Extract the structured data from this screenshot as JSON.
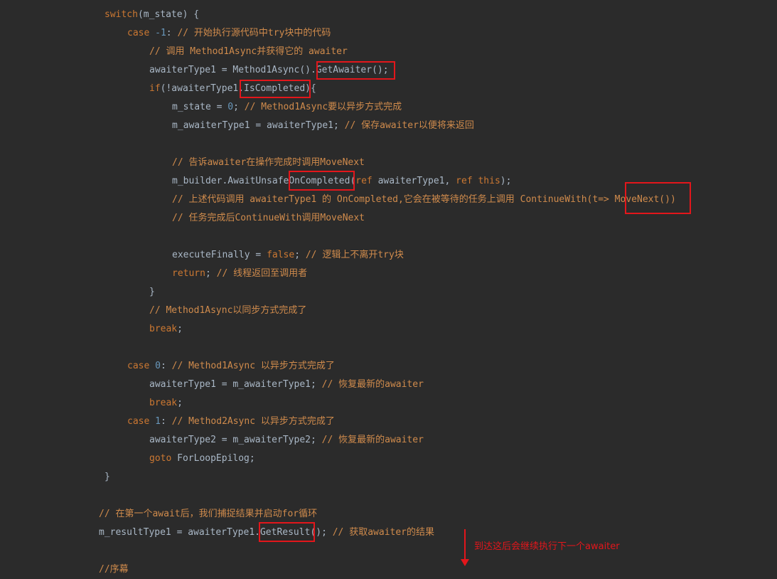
{
  "code_lines": [
    [
      {
        "t": "switch",
        "c": "kw"
      },
      {
        "t": "(m_state) {",
        "c": "pl"
      }
    ],
    [
      {
        "t": "case ",
        "c": "kw"
      },
      {
        "t": "-1",
        "c": "num"
      },
      {
        "t": ": ",
        "c": "pl"
      },
      {
        "t": "// 开始执行源代码中try块中的代码",
        "c": "cm"
      }
    ],
    [
      {
        "t": "// 调用 Method1Async并获得它的 awaiter",
        "c": "cm"
      }
    ],
    [
      {
        "t": "awaiterType1 = Method1Async().GetAwaiter();",
        "c": "pl"
      }
    ],
    [
      {
        "t": "if",
        "c": "kw"
      },
      {
        "t": "(!awaiterType1.IsCompleted){",
        "c": "pl"
      }
    ],
    [
      {
        "t": "m_state = ",
        "c": "pl"
      },
      {
        "t": "0",
        "c": "num"
      },
      {
        "t": "; ",
        "c": "pl"
      },
      {
        "t": "// Method1Async要以异步方式完成",
        "c": "cm"
      }
    ],
    [
      {
        "t": "m_awaiterType1 = awaiterType1; ",
        "c": "pl"
      },
      {
        "t": "// 保存awaiter以便将来返回",
        "c": "cm"
      }
    ],
    [],
    [
      {
        "t": "// 告诉awaiter在操作完成时调用MoveNext",
        "c": "cm"
      }
    ],
    [
      {
        "t": "m_builder.AwaitUnsafeOnCompleted(",
        "c": "pl"
      },
      {
        "t": "ref ",
        "c": "kw"
      },
      {
        "t": "awaiterType1, ",
        "c": "pl"
      },
      {
        "t": "ref ",
        "c": "kw"
      },
      {
        "t": "this",
        "c": "kw"
      },
      {
        "t": ");",
        "c": "pl"
      }
    ],
    [
      {
        "t": "// 上述代码调用 awaiterType1 的 OnCompleted,它会在被等待的任务上调用 ContinueWith(t=> MoveNext())",
        "c": "cm"
      }
    ],
    [
      {
        "t": "// 任务完成后ContinueWith调用MoveNext",
        "c": "cm"
      }
    ],
    [],
    [
      {
        "t": "executeFinally = ",
        "c": "pl"
      },
      {
        "t": "false",
        "c": "kw"
      },
      {
        "t": "; ",
        "c": "pl"
      },
      {
        "t": "// 逻辑上不离开try块",
        "c": "cm"
      }
    ],
    [
      {
        "t": "return",
        "c": "kw"
      },
      {
        "t": "; ",
        "c": "pl"
      },
      {
        "t": "// 线程返回至调用者",
        "c": "cm"
      }
    ],
    [
      {
        "t": "}",
        "c": "pl"
      }
    ],
    [
      {
        "t": "// Method1Async以同步方式完成了",
        "c": "cm"
      }
    ],
    [
      {
        "t": "break",
        "c": "kw"
      },
      {
        "t": ";",
        "c": "pl"
      }
    ],
    [],
    [
      {
        "t": "case ",
        "c": "kw"
      },
      {
        "t": "0",
        "c": "num"
      },
      {
        "t": ": ",
        "c": "pl"
      },
      {
        "t": "// Method1Async 以异步方式完成了",
        "c": "cm"
      }
    ],
    [
      {
        "t": "awaiterType1 = m_awaiterType1; ",
        "c": "pl"
      },
      {
        "t": "// 恢复最新的awaiter",
        "c": "cm"
      }
    ],
    [
      {
        "t": "break",
        "c": "kw"
      },
      {
        "t": ";",
        "c": "pl"
      }
    ],
    [
      {
        "t": "case ",
        "c": "kw"
      },
      {
        "t": "1",
        "c": "num"
      },
      {
        "t": ": ",
        "c": "pl"
      },
      {
        "t": "// Method2Async 以异步方式完成了",
        "c": "cm"
      }
    ],
    [
      {
        "t": "awaiterType2 = m_awaiterType2; ",
        "c": "pl"
      },
      {
        "t": "// 恢复最新的awaiter",
        "c": "cm"
      }
    ],
    [
      {
        "t": "goto ",
        "c": "kw"
      },
      {
        "t": "ForLoopEpilog;",
        "c": "pl"
      }
    ],
    [
      {
        "t": "}",
        "c": "pl"
      }
    ],
    [],
    [
      {
        "t": "// 在第一个await后，我们捕捉结果并启动for循环",
        "c": "cm"
      }
    ],
    [
      {
        "t": "m_resultType1 = awaiterType1.GetResult(); ",
        "c": "pl"
      },
      {
        "t": "// 获取awaiter的结果",
        "c": "cm"
      }
    ],
    [],
    [
      {
        "t": "//序幕",
        "c": "cm"
      }
    ]
  ],
  "highlights": [
    "GetAwaiter();",
    "IsCompleted",
    "OnCompleted",
    "MoveNext()",
    "GetResult"
  ],
  "annotation": {
    "note": "到达这后会继续执行下一个awaiter",
    "color": "#e3161b"
  },
  "colors": {
    "background": "#2b2b2b",
    "keyword": "#cc7832",
    "number": "#6897bb",
    "comment": "#d08b4c",
    "plain": "#a9b7c6",
    "highlight_box": "#e3161b"
  }
}
